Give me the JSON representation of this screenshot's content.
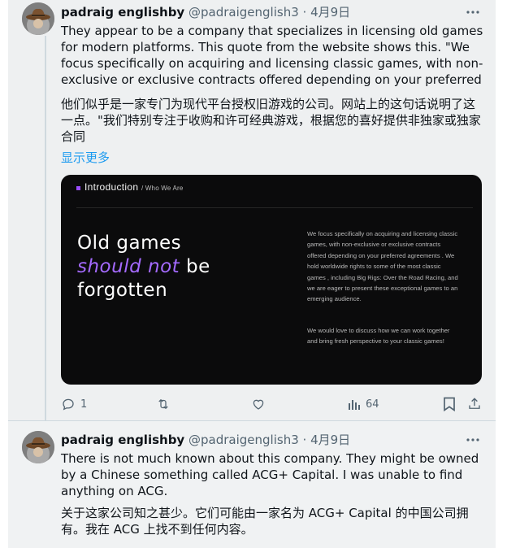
{
  "tweets": [
    {
      "author_name": "padraig englishby",
      "handle": "@padraigenglish3",
      "separator": "·",
      "date": "4月9日",
      "text": "They appear to be a company that specializes in licensing old games for modern platforms. This quote from the website shows this. \"We focus specifically on acquiring and licensing classic games, with non-exclusive or exclusive contracts offered depending on your preferred",
      "translation": "他们似乎是一家专门为现代平台授权旧游戏的公司。网站上的这句话说明了这一点。\"我们特别专注于收购和许可经典游戏，根据您的喜好提供非独家或独家合同",
      "show_more": "显示更多",
      "card": {
        "section_title": "Introduction",
        "section_subtitle": "/ Who We Are",
        "headline_line1": "Old games",
        "headline_accent": "should not",
        "headline_be": " be",
        "headline_line3": "forgotten",
        "paragraph1": "We focus specifically on acquiring and licensing classic games, with non-exclusive or exclusive contracts offered depending on your preferred agreements . We hold worldwide rights to some of the most classic games , including Big Rigs: Over the Road Racing, and we are eager to present these exceptional games to an emerging audience.",
        "paragraph2": "We would love to discuss how we can work together and bring fresh perspective to your classic games!",
        "accent_color": "#a46aff"
      },
      "replies": "1",
      "views": "64"
    },
    {
      "author_name": "padraig englishby",
      "handle": "@padraigenglish3",
      "separator": "·",
      "date": "4月9日",
      "text": "There is not much known about this company. They might be owned by a Chinese something called ACG+ Capital. I was unable to find anything on ACG.",
      "translation": "关于这家公司知之甚少。它们可能由一家名为 ACG+ Capital 的中国公司拥有。我在 ACG 上找不到任何内容。"
    }
  ],
  "icons": {
    "more": "more-horizontal-icon",
    "reply": "reply-icon",
    "retweet": "retweet-icon",
    "like": "heart-icon",
    "views": "views-chart-icon",
    "bookmark": "bookmark-icon",
    "share": "share-icon"
  },
  "colors": {
    "link": "#1d9bf0",
    "secondary_text": "#536471",
    "background": "#eef0f1"
  }
}
